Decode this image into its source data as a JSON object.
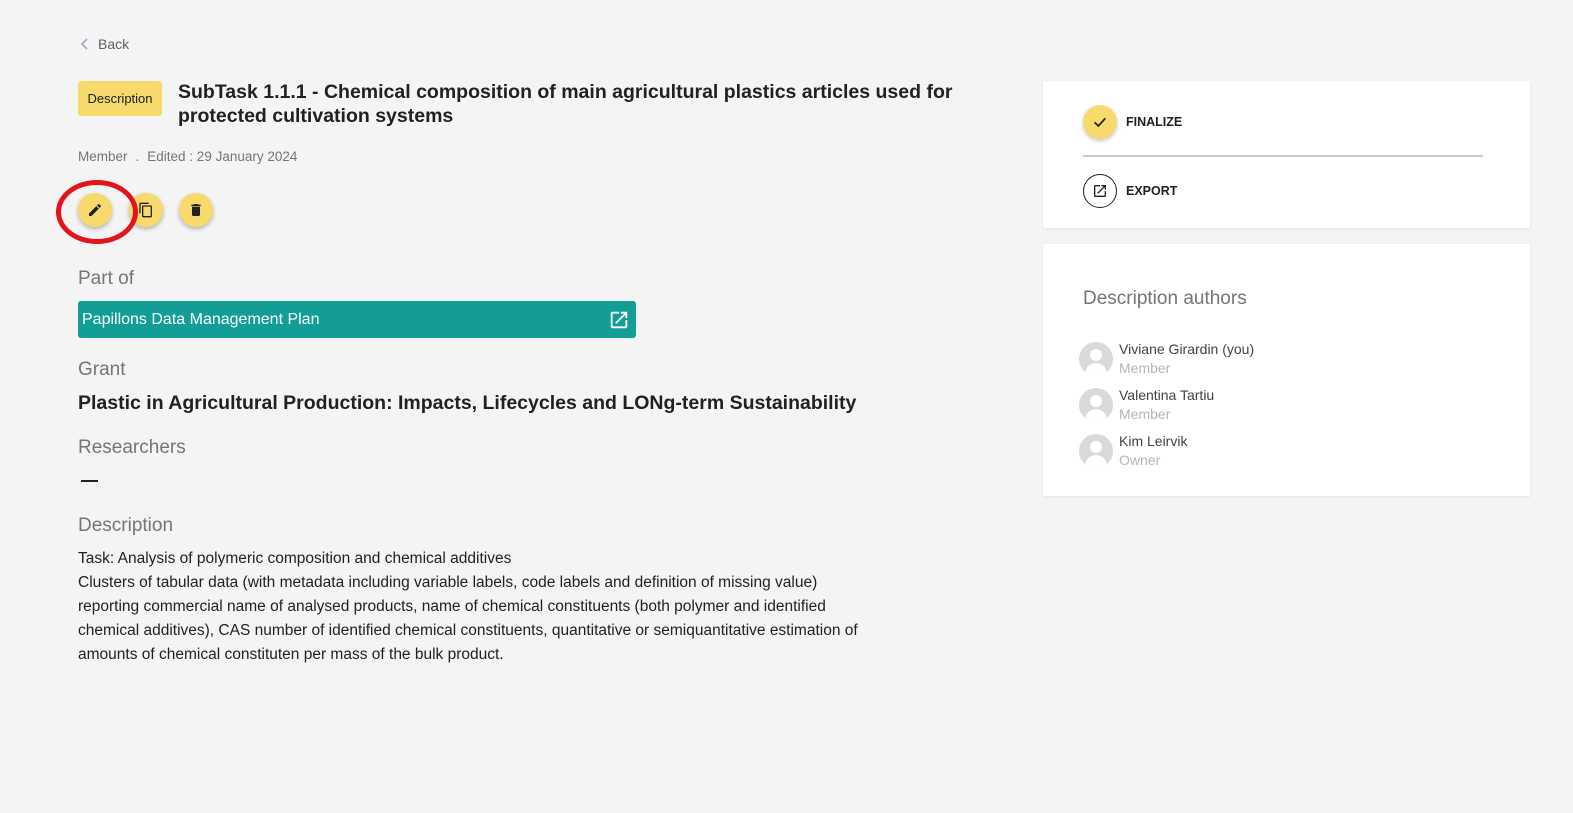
{
  "nav": {
    "back_label": "Back"
  },
  "header": {
    "badge": "Description",
    "title": "SubTask 1.1.1 - Chemical composition of main agricultural plastics articles used for protected cultivation systems",
    "role": "Member",
    "separator": ".",
    "edited": "Edited : 29 January 2024"
  },
  "actions": [
    {
      "name": "edit",
      "icon": "pencil-icon"
    },
    {
      "name": "clone",
      "icon": "copy-icon"
    },
    {
      "name": "delete",
      "icon": "trash-icon"
    }
  ],
  "part_of": {
    "label": "Part of",
    "plan": "Papillons Data Management Plan",
    "icon": "open-in-new-icon"
  },
  "grant": {
    "label": "Grant",
    "value": "Plastic in Agricultural Production: Impacts, Lifecycles and LONg-term Sustainability"
  },
  "researchers": {
    "label": "Researchers",
    "value": "—"
  },
  "description": {
    "label": "Description",
    "line1": "Task: Analysis of polymeric composition and chemical additives",
    "line2": "Clusters of tabular data (with metadata including variable labels, code labels and definition of missing value) reporting commercial name of analysed products, name of chemical constituents (both polymer and identified chemical additives), CAS number of identified chemical constituents, quantitative or semiquantitative estimation of amounts of chemical constituten per mass of the bulk product."
  },
  "sidebar": {
    "finalize": "FINALIZE",
    "export": "EXPORT",
    "authors_title": "Description authors",
    "authors": [
      {
        "name": "Viviane Girardin (you)",
        "role": "Member"
      },
      {
        "name": "Valentina Tartiu",
        "role": "Member"
      },
      {
        "name": "Kim Leirvik",
        "role": "Owner"
      }
    ]
  },
  "colors": {
    "accent_yellow": "#f7da6b",
    "plan_teal": "#129d97",
    "highlight_red": "#e3141b",
    "background": "#f4f4f4"
  }
}
